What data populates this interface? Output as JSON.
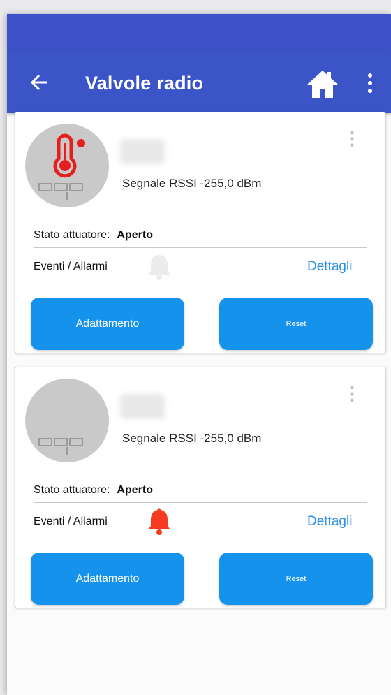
{
  "appbar": {
    "title": "Valvole radio",
    "back_icon": "arrow-left-icon",
    "home_icon": "home-icon",
    "menu_icon": "more-vertical-icon",
    "color": "#3b55c9"
  },
  "cards": [
    {
      "signal": "Segnale RSSI -255,0 dBm",
      "stato_label": "Stato attuatore:",
      "stato_value": "Aperto",
      "eventi_label": "Eventi / Allarmi",
      "dettagli": "Dettagli",
      "btn_adattamento": "Adattamento",
      "btn_reset": "Reset",
      "alarm_active": false,
      "temp_alert": true
    },
    {
      "signal": "Segnale RSSI -255,0 dBm",
      "stato_label": "Stato attuatore:",
      "stato_value": "Aperto",
      "eventi_label": "Eventi / Allarmi",
      "dettagli": "Dettagli",
      "btn_adattamento": "Adattamento",
      "btn_reset": "Reset",
      "alarm_active": true,
      "temp_alert": false
    }
  ],
  "colors": {
    "accent": "#1592ec",
    "link": "#2b8fe8",
    "alarm": "#f43a1f"
  }
}
